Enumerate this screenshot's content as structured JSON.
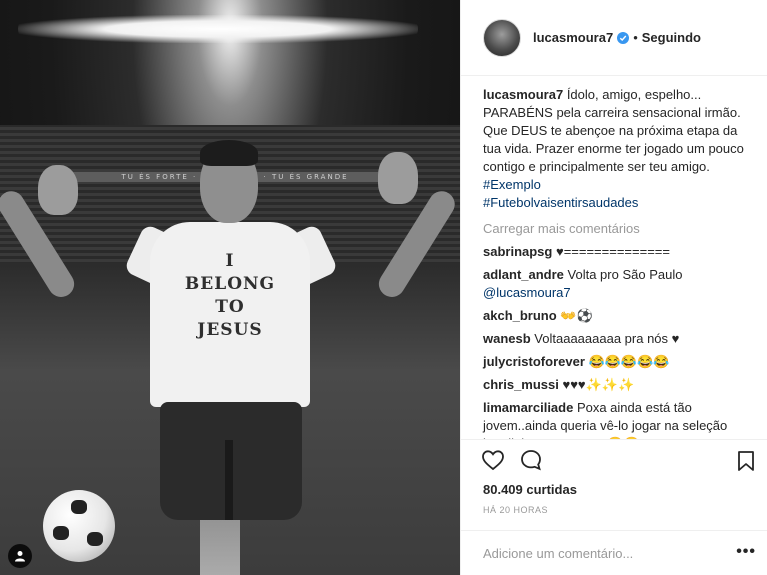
{
  "photo": {
    "stand_banner": "TU ÉS FORTE · SÃO PAULO · TU ÉS GRANDE",
    "shirt_lines": [
      "I",
      "BELONG",
      "TO",
      "JESUS"
    ]
  },
  "header": {
    "username": "lucasmoura7",
    "separator": "•",
    "follow_status": "Seguindo"
  },
  "caption": {
    "username": "lucasmoura7",
    "text": " Ídolo, amigo, espelho... PARABÉNS pela carreira sensacional irmão. Que DEUS te abençoe na próxima etapa da tua vida. Prazer enorme ter jogado um pouco contigo e principalmente ser teu amigo. ",
    "hashtag_1": "#Exemplo",
    "hashtag_2": "#Futebolvaisentirsaudades"
  },
  "load_more": "Carregar mais comentários",
  "comments": [
    {
      "user": "sabrinapsg",
      "text": " ♥=============="
    },
    {
      "user": "adlant_andre",
      "text": " Volta pro São Paulo ",
      "mention": "@lucasmoura7"
    },
    {
      "user": "akch_bruno",
      "text": " 👐⚽"
    },
    {
      "user": "wanesb",
      "text": " Voltaaaaaaaaa pra nós ♥"
    },
    {
      "user": "julycristoforever",
      "text": " 😂😂😂😂😂"
    },
    {
      "user": "chris_mussi",
      "text": " ♥♥♥✨✨✨"
    },
    {
      "user": "limamarciliade",
      "text": " Poxa ainda está tão jovem..ainda queria vê-lo jogar na seleção brasileira novamente 😪😪"
    }
  ],
  "stats": {
    "likes": "80.409 curtidas",
    "time": "HÁ 20 HORAS"
  },
  "comment_box": {
    "placeholder": "Adicione um comentário...",
    "more": "•••"
  },
  "icons": {
    "like": "heart-icon",
    "comment": "speech-bubble-icon",
    "save": "bookmark-icon",
    "tag": "person-tag-icon",
    "verified": "verified-badge-icon"
  },
  "colors": {
    "verified": "#3897f0",
    "hashtag": "#003569",
    "muted": "#999999",
    "text": "#262626",
    "border": "#efefef"
  }
}
